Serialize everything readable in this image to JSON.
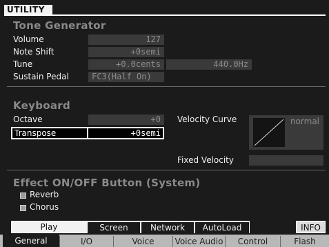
{
  "title": "UTILITY",
  "tone_generator": {
    "heading": "Tone Generator",
    "volume": {
      "label": "Volume",
      "value": "127"
    },
    "note_shift": {
      "label": "Note Shift",
      "value": "+0semi"
    },
    "tune": {
      "label": "Tune",
      "value": "+0.0cents",
      "hz": "440.0Hz"
    },
    "sustain_pedal": {
      "label": "Sustain Pedal",
      "value": "FC3(Half On)"
    }
  },
  "keyboard": {
    "heading": "Keyboard",
    "octave": {
      "label": "Octave",
      "value": "+0"
    },
    "transpose": {
      "label": "Transpose",
      "value": "+0semi"
    },
    "velocity_curve": {
      "label": "Velocity Curve",
      "value": "normal"
    },
    "fixed_velocity": {
      "label": "Fixed Velocity",
      "value": ""
    }
  },
  "effect": {
    "heading": "Effect ON/OFF Button (System)",
    "reverb": {
      "label": "Reverb",
      "checked": true
    },
    "chorus": {
      "label": "Chorus",
      "checked": true
    }
  },
  "subtabs": [
    "Play",
    "Screen",
    "Network",
    "AutoLoad"
  ],
  "info_button": "INFO",
  "main_tabs": [
    "General",
    "I/O",
    "Voice",
    "Voice Audio",
    "Control",
    "Flash"
  ],
  "active_main_tab": "General",
  "colors": {
    "background": "#1b1b1b",
    "field": "#3a3a3a",
    "heading": "#8a8a8a",
    "highlight": "#ffffff"
  }
}
